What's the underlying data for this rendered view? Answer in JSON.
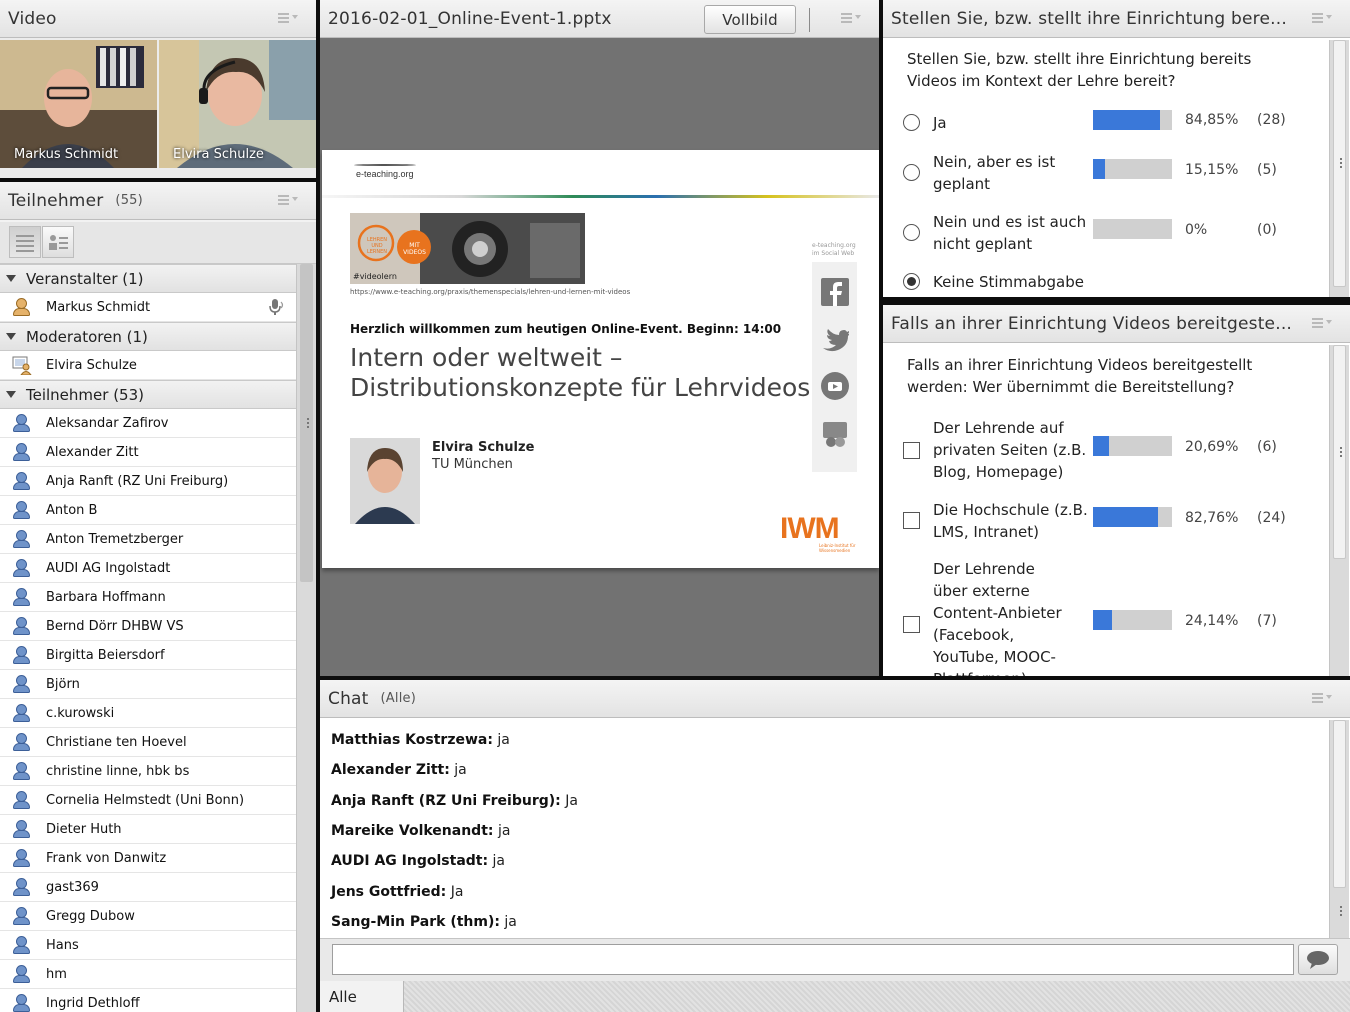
{
  "video": {
    "title": "Video",
    "people": [
      {
        "name": "Markus Schmidt"
      },
      {
        "name": "Elvira Schulze"
      }
    ]
  },
  "attendees": {
    "title": "Teilnehmer",
    "count": "(55)",
    "groups": {
      "hosts": "Veranstalter (1)",
      "presenters": "Moderatoren (1)",
      "participants": "Teilnehmer (53)"
    },
    "host": "Markus Schmidt",
    "presenter": "Elvira Schulze",
    "people": [
      "Aleksandar Zafirov",
      "Alexander Zitt",
      "Anja Ranft (RZ Uni Freiburg)",
      "Anton B",
      "Anton Tremetzberger",
      "AUDI AG Ingolstadt",
      "Barbara Hoffmann",
      "Bernd Dörr DHBW VS",
      "Birgitta Beiersdorf",
      "Björn",
      "c.kurowski",
      "Christiane ten Hoevel",
      "christine linne, hbk bs",
      "Cornelia Helmstedt (Uni Bonn)",
      "Dieter Huth",
      "Frank von Danwitz",
      "gast369",
      "Gregg Dubow",
      "Hans",
      "hm",
      "Ingrid Dethloff"
    ]
  },
  "share": {
    "file": "2016-02-01_Online-Event-1.pptx",
    "fullscreen_label": "Vollbild",
    "slide": {
      "logo_text": "e-teaching.org",
      "badge1": "LEHREN UND LERNEN",
      "badge2": "MIT VIDEOS",
      "hashtag": "#videolern",
      "url": "https://www.e-teaching.org/praxis/themenspecials/lehren-und-lernen-mit-videos",
      "welcome": "Herzlich willkommen zum heutigen Online-Event. Beginn: 14:00",
      "title_line1": "Intern oder weltweit –",
      "title_line2": "Distributionskonzepte für Lehrvideos",
      "speaker_name": "Elvira Schulze",
      "speaker_org": "TU München",
      "side_text_1": "e-teaching.org",
      "side_text_2": "im Social Web",
      "iwm_logo": "IWM",
      "iwm_sub_1": "Leibniz-Institut für",
      "iwm_sub_2": "Wissensmedien"
    }
  },
  "poll1": {
    "title": "Stellen Sie, bzw. stellt ihre Einrichtung bere...",
    "question": "Stellen Sie, bzw. stellt ihre Einrichtung bereits Videos im Kontext der Lehre bereit?",
    "options": [
      {
        "label": "Ja",
        "percent": "84,85%",
        "count": "(28)",
        "fraction": 0.8485
      },
      {
        "label": "Nein, aber es ist geplant",
        "percent": "15,15%",
        "count": "(5)",
        "fraction": 0.1515
      },
      {
        "label": "Nein und es ist auch nicht geplant",
        "percent": "0%",
        "count": "(0)",
        "fraction": 0
      },
      {
        "label": "Keine Stimmabgabe"
      }
    ]
  },
  "poll2": {
    "title": "Falls an ihrer Einrichtung Videos bereitgeste...",
    "question": "Falls an ihrer Einrichtung Videos bereitgestellt werden: Wer übernimmt die Bereitstellung?",
    "options": [
      {
        "label": "Der Lehrende auf privaten Seiten (z.B. Blog, Homepage)",
        "percent": "20,69%",
        "count": "(6)",
        "fraction": 0.2069
      },
      {
        "label": "Die Hochschule (z.B. LMS, Intranet)",
        "percent": "82,76%",
        "count": "(24)",
        "fraction": 0.8276
      },
      {
        "label": "Der Lehrende über externe Content-Anbieter (Facebook, YouTube, MOOC-Plattformen)",
        "percent": "24,14%",
        "count": "(7)",
        "fraction": 0.2414
      }
    ]
  },
  "chat": {
    "title": "Chat",
    "scope": "(Alle)",
    "messages": [
      {
        "name": "Matthias Kostrzewa:",
        "text": " ja"
      },
      {
        "name": "Alexander Zitt:",
        "text": " ja"
      },
      {
        "name": "Anja Ranft (RZ Uni Freiburg):",
        "text": " Ja"
      },
      {
        "name": "Mareike Volkenandt:",
        "text": " ja"
      },
      {
        "name": "AUDI AG Ingolstadt:",
        "text": " ja"
      },
      {
        "name": "Jens Gottfried:",
        "text": " Ja"
      },
      {
        "name": "Sang-Min Park (thm):",
        "text": " ja"
      }
    ],
    "tab": "Alle"
  },
  "colors": {
    "bar_fill": "#3a78d9",
    "bar_track": "#d0d0d0",
    "iwm_orange": "#e8731e"
  }
}
